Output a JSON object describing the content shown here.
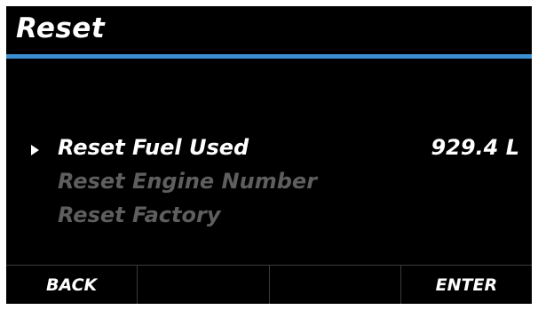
{
  "screen": {
    "title": "Reset",
    "accent_color": "#3b8fd0"
  },
  "menu": {
    "items": [
      {
        "label": "Reset Fuel Used",
        "value": "929.4 L",
        "state": "selected"
      },
      {
        "label": "Reset Engine Number",
        "value": "",
        "state": "disabled"
      },
      {
        "label": "Reset Factory",
        "value": "",
        "state": "disabled"
      }
    ],
    "pointer_icon": "triangle-right-icon"
  },
  "softkeys": [
    {
      "label": "BACK"
    },
    {
      "label": ""
    },
    {
      "label": ""
    },
    {
      "label": "ENTER"
    }
  ]
}
